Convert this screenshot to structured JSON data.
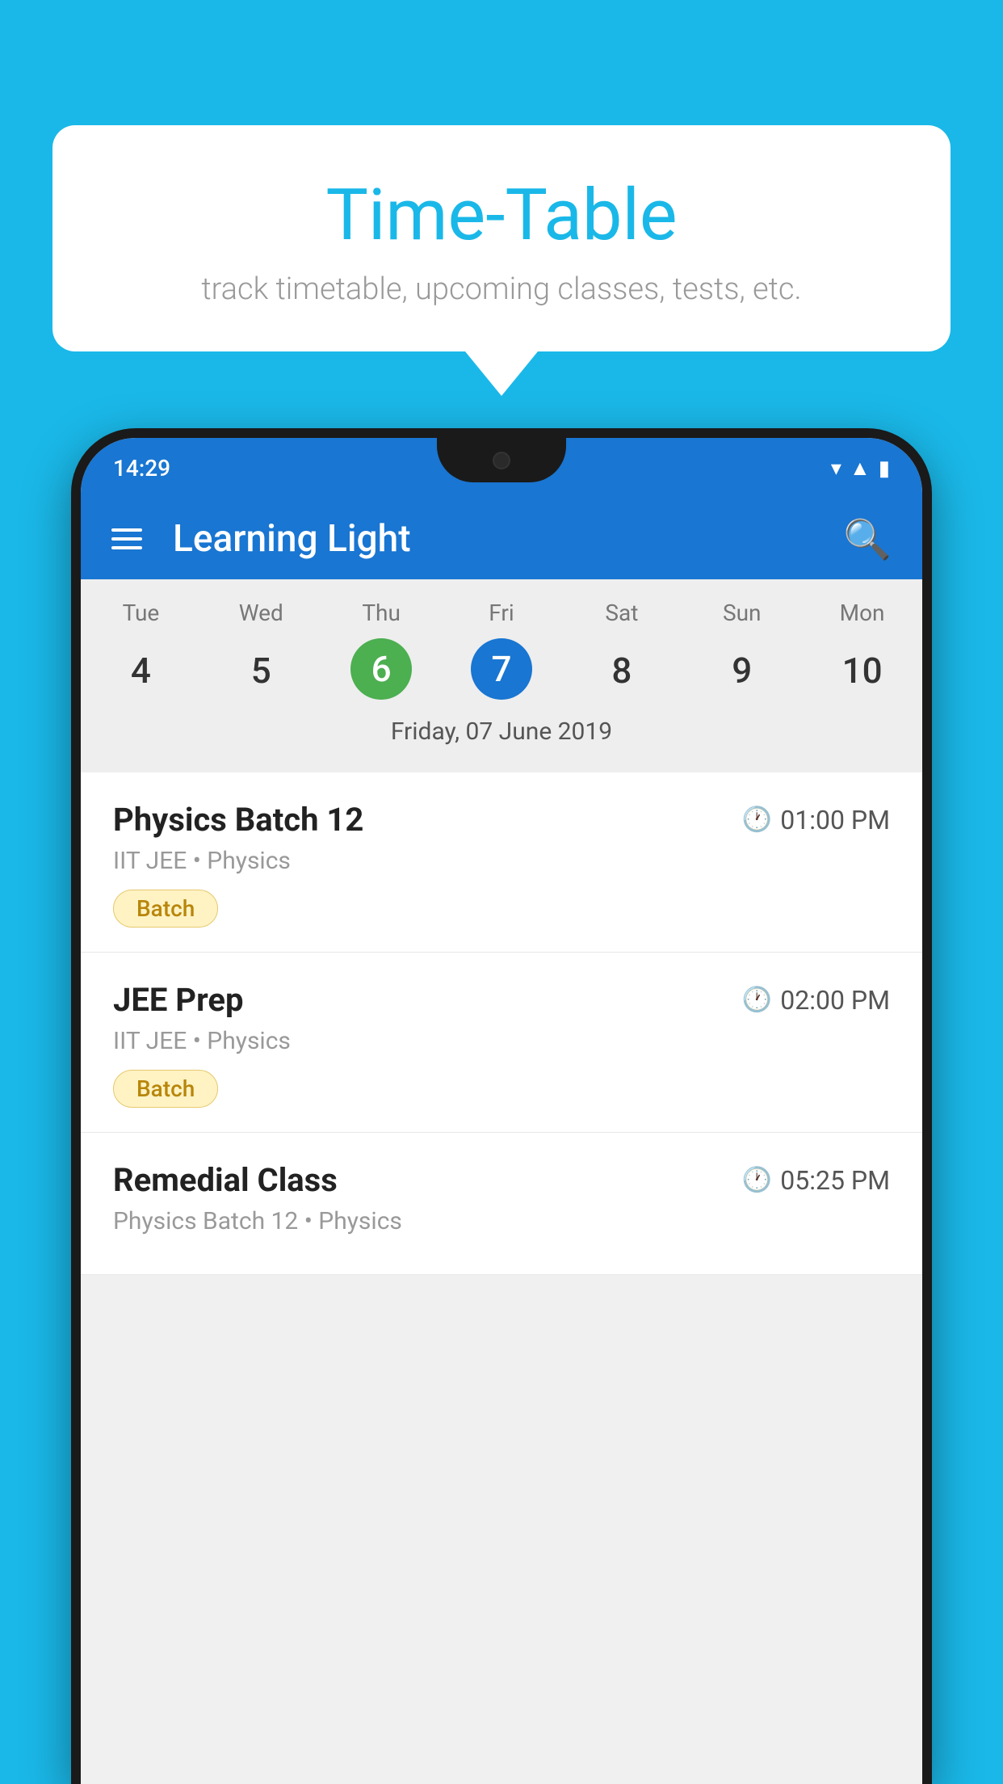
{
  "background_color": "#1ab8e8",
  "speech_bubble": {
    "title": "Time-Table",
    "subtitle": "track timetable, upcoming classes, tests, etc."
  },
  "phone": {
    "status_bar": {
      "time": "14:29"
    },
    "app_header": {
      "title": "Learning Light",
      "menu_icon": "hamburger-icon",
      "search_icon": "search-icon"
    },
    "calendar": {
      "days": [
        "Tue",
        "Wed",
        "Thu",
        "Fri",
        "Sat",
        "Sun",
        "Mon"
      ],
      "dates": [
        "4",
        "5",
        "6",
        "7",
        "8",
        "9",
        "10"
      ],
      "today_index": 2,
      "selected_index": 3,
      "date_label": "Friday, 07 June 2019"
    },
    "schedule": [
      {
        "title": "Physics Batch 12",
        "time": "01:00 PM",
        "sub": "IIT JEE • Physics",
        "badge": "Batch"
      },
      {
        "title": "JEE Prep",
        "time": "02:00 PM",
        "sub": "IIT JEE • Physics",
        "badge": "Batch"
      },
      {
        "title": "Remedial Class",
        "time": "05:25 PM",
        "sub": "Physics Batch 12 • Physics",
        "badge": null
      }
    ]
  }
}
